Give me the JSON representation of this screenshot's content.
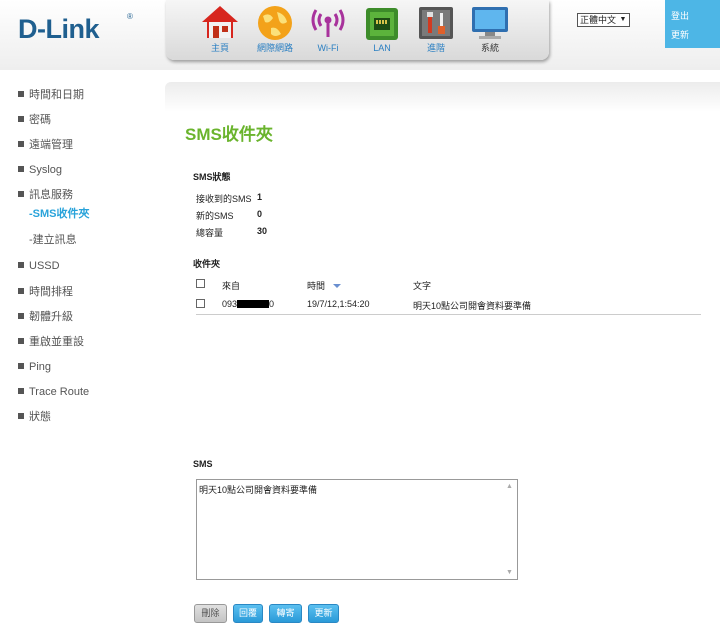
{
  "header": {
    "logo": "D-Link",
    "logo_mark": "®",
    "nav": [
      {
        "label": "主頁",
        "icon": "home-icon"
      },
      {
        "label": "網際網路",
        "icon": "globe-icon"
      },
      {
        "label": "Wi-Fi",
        "icon": "wifi-icon"
      },
      {
        "label": "LAN",
        "icon": "lan-icon"
      },
      {
        "label": "進階",
        "icon": "tools-icon"
      },
      {
        "label": "系統",
        "icon": "monitor-icon"
      }
    ],
    "language": "正體中文",
    "logout": "登出",
    "update": "更新"
  },
  "sidebar": {
    "items": [
      {
        "label": "時間和日期"
      },
      {
        "label": "密碼"
      },
      {
        "label": "遠端管理"
      },
      {
        "label": "Syslog"
      },
      {
        "label": "訊息服務"
      },
      {
        "label": "USSD"
      },
      {
        "label": "時間排程"
      },
      {
        "label": "韌體升級"
      },
      {
        "label": "重啟並重設"
      },
      {
        "label": "Ping"
      },
      {
        "label": "Trace Route"
      },
      {
        "label": "狀態"
      }
    ],
    "sub_items": [
      {
        "label": "-SMS收件夾",
        "active": true
      },
      {
        "label": "-建立訊息",
        "active": false
      }
    ]
  },
  "main": {
    "title": "SMS收件夾",
    "status_title": "SMS狀態",
    "status": [
      {
        "label": "接收到的SMS",
        "value": "1"
      },
      {
        "label": "新的SMS",
        "value": "0"
      },
      {
        "label": "總容量",
        "value": "30"
      }
    ],
    "inbox_title": "收件夾",
    "columns": {
      "from": "來自",
      "time": "時間",
      "text": "文字"
    },
    "rows": [
      {
        "from_prefix": "093",
        "from_suffix": "0",
        "time": "19/7/12,1:54:20",
        "text": "明天10點公司開會資料要準備"
      }
    ],
    "sms_label": "SMS",
    "sms_content": "明天10點公司開會資料要準備",
    "buttons": {
      "delete": "刪除",
      "reply": "回覆",
      "forward": "轉寄",
      "refresh": "更新"
    }
  },
  "colors": {
    "accent": "#29a3da",
    "title": "#6ab42d",
    "logo": "#1f5f8f",
    "side_box": "#4db6e6"
  }
}
